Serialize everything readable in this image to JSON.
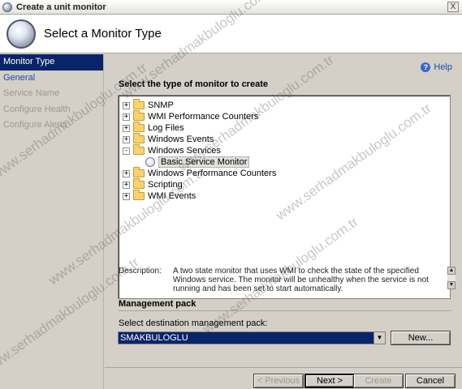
{
  "window": {
    "title": "Create a unit monitor",
    "close_glyph": "X"
  },
  "header": {
    "title": "Select a Monitor Type"
  },
  "sidebar": {
    "items": [
      {
        "label": "Monitor Type",
        "state": "active"
      },
      {
        "label": "General",
        "state": "link"
      },
      {
        "label": "Service Name",
        "state": "disabled"
      },
      {
        "label": "Configure Health",
        "state": "disabled"
      },
      {
        "label": "Configure Alerts",
        "state": "disabled"
      }
    ]
  },
  "help": {
    "label": "Help"
  },
  "section": {
    "title": "Select the type of monitor to create"
  },
  "tree": {
    "nodes": [
      {
        "label": "SNMP",
        "expander": "+",
        "icon": "folder-icon"
      },
      {
        "label": "WMI Performance Counters",
        "expander": "+",
        "icon": "folder-icon"
      },
      {
        "label": "Log Files",
        "expander": "+",
        "icon": "folder-icon"
      },
      {
        "label": "Windows Events",
        "expander": "+",
        "icon": "folder-icon"
      },
      {
        "label": "Windows Services",
        "expander": "-",
        "icon": "folder-open-icon"
      },
      {
        "label": "Basic Service Monitor",
        "expander": "",
        "icon": "monitor-icon",
        "selected": true
      },
      {
        "label": "Windows Performance Counters",
        "expander": "+",
        "icon": "folder-icon"
      },
      {
        "label": "Scripting",
        "expander": "+",
        "icon": "folder-icon"
      },
      {
        "label": "WMI Events",
        "expander": "+",
        "icon": "folder-icon"
      }
    ]
  },
  "description": {
    "label": "Description:",
    "text": "A two state monitor that uses WMI to check the state of the specified Windows service. The monitor will be unhealthy when the service is not running and has been set to start automatically."
  },
  "management_pack": {
    "title": "Management pack",
    "select_label": "Select destination management pack:",
    "selected_value": "SMAKBULOGLU",
    "new_button": "New..."
  },
  "buttons": {
    "previous": "< Previous",
    "next": "Next >",
    "create": "Create",
    "cancel": "Cancel"
  },
  "watermark": {
    "text": "www.serhadmakbuloglu.com.tr"
  },
  "colors": {
    "selection": "#0a246a",
    "link": "#1a4aa8",
    "disabled": "#9a9890",
    "dialog": "#d4d0c8"
  }
}
